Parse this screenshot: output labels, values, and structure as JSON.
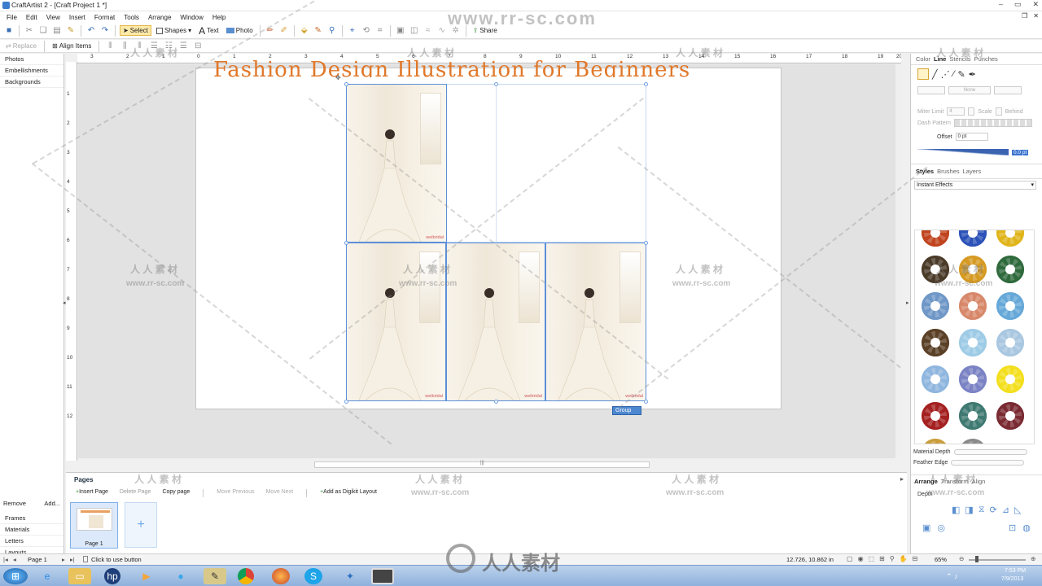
{
  "window": {
    "title": "CraftArtist 2 - [Craft Project 1 *]"
  },
  "menu": [
    "File",
    "Edit",
    "View",
    "Insert",
    "Format",
    "Tools",
    "Arrange",
    "Window",
    "Help"
  ],
  "toolbar": {
    "select_label": "Select",
    "shapes_label": "Shapes",
    "text_label": "Text",
    "photo_label": "Photo",
    "share_label": "Share"
  },
  "toolbar2": {
    "replace_label": "Replace",
    "align_label": "Align Items"
  },
  "left_panel": {
    "top_items": [
      "Photos",
      "Embellishments",
      "Backgrounds"
    ],
    "remove_label": "Remove",
    "add_label": "Add...",
    "bottom_items": [
      "Frames",
      "Materials",
      "Letters",
      "Layouts"
    ]
  },
  "ruler": {
    "h_numbers": [
      "3",
      "2",
      "1",
      "0",
      "1",
      "2",
      "3",
      "4",
      "5",
      "6",
      "7",
      "8",
      "9",
      "10",
      "11",
      "12",
      "13",
      "14",
      "15",
      "16",
      "17",
      "18",
      "19",
      "20"
    ],
    "v_numbers": [
      "1",
      "2",
      "3",
      "4",
      "5",
      "6",
      "7",
      "8",
      "9",
      "10",
      "11",
      "12"
    ]
  },
  "canvas": {
    "page_title": "Fashion Design Illustration for Beginners",
    "photo_watermark": "weibridal",
    "group_tag": "Group"
  },
  "right_panel": {
    "tabs_top": [
      "Color",
      "Line",
      "Stencils",
      "Punches"
    ],
    "line_none": "None",
    "miter_label": "Miter Limit",
    "miter_value": "4",
    "scale_label": "Scale",
    "behind_label": "Behind",
    "dash_label": "Dash Pattern",
    "offset_label": "Offset",
    "offset_value": "0 pt",
    "weight_value": "0.0 pt",
    "tabs_styles": [
      "Styles",
      "Brushes",
      "Layers"
    ],
    "styles_dropdown": "Instant Effects",
    "material_depth_label": "Material Depth",
    "feather_edge_label": "Feather Edge",
    "tabs_arrange": [
      "Arrange",
      "Transform",
      "Align"
    ],
    "depth_label": "Depth"
  },
  "gear_colors": [
    "#c0451f",
    "#2c52b8",
    "#e0b51c",
    "#4a3a28",
    "#d69a22",
    "#2f6a3c",
    "#6f97c7",
    "#d8886a",
    "#66a8d8",
    "#5a4026",
    "#9ecbe6",
    "#a9c7e0",
    "#8fb6de",
    "#7b83c4",
    "#f3df1e",
    "#a52020",
    "#3f7a72",
    "#7a2a32",
    "#c99d3c",
    "#8a8a8a"
  ],
  "pages_bar": {
    "title": "Pages",
    "insert_page": "Insert Page",
    "delete_page": "Delete Page",
    "copy_page": "Copy page",
    "move_previous": "Move Previous",
    "move_next": "Move Next",
    "add_digikit": "Add as Digikit Layout",
    "page1_label": "Page 1"
  },
  "status": {
    "page_label": "Page 1",
    "hint": "Click to use button",
    "coords": "12.726, 10.862 in",
    "zoom": "65%"
  },
  "taskbar": {
    "time": "7:53 PM",
    "date": "7/9/2013"
  },
  "watermarks": {
    "url_top": "www.rr-sc.com",
    "cn_small": "人 人 素 材",
    "url_small": "www.rr-sc.com",
    "cn_big": "人人素材"
  }
}
